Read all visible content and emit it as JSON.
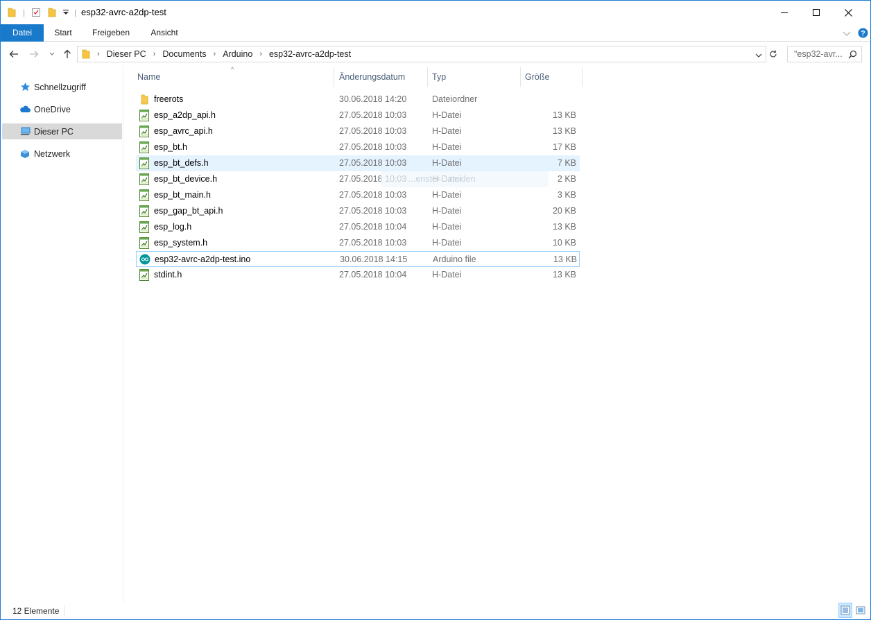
{
  "window": {
    "title": "esp32-avrc-a2dp-test"
  },
  "ribbon": {
    "tabs": [
      {
        "label": "Datei",
        "active": true
      },
      {
        "label": "Start",
        "active": false
      },
      {
        "label": "Freigeben",
        "active": false
      },
      {
        "label": "Ansicht",
        "active": false
      }
    ]
  },
  "address": {
    "breadcrumbs": [
      "Dieser PC",
      "Documents",
      "Arduino",
      "esp32-avrc-a2dp-test"
    ],
    "search_placeholder": "\"esp32-avr..."
  },
  "sidebar": {
    "items": [
      {
        "label": "Schnellzugriff",
        "icon": "star-icon",
        "selected": false
      },
      {
        "label": "OneDrive",
        "icon": "cloud-icon",
        "selected": false
      },
      {
        "label": "Dieser PC",
        "icon": "computer-icon",
        "selected": true
      },
      {
        "label": "Netzwerk",
        "icon": "network-icon",
        "selected": false
      }
    ]
  },
  "columns": {
    "name": "Name",
    "date": "Änderungsdatum",
    "type": "Typ",
    "size": "Größe"
  },
  "files": [
    {
      "name": "freerots",
      "date": "30.06.2018 14:20",
      "type": "Dateiordner",
      "size": "",
      "icon": "folder-icon"
    },
    {
      "name": "esp_a2dp_api.h",
      "date": "27.05.2018 10:03",
      "type": "H-Datei",
      "size": "13 KB",
      "icon": "header-file-icon"
    },
    {
      "name": "esp_avrc_api.h",
      "date": "27.05.2018 10:03",
      "type": "H-Datei",
      "size": "13 KB",
      "icon": "header-file-icon"
    },
    {
      "name": "esp_bt.h",
      "date": "27.05.2018 10:03",
      "type": "H-Datei",
      "size": "17 KB",
      "icon": "header-file-icon"
    },
    {
      "name": "esp_bt_defs.h",
      "date": "27.05.2018 10:03",
      "type": "H-Datei",
      "size": "7 KB",
      "icon": "header-file-icon",
      "state": "hover"
    },
    {
      "name": "esp_bt_device.h",
      "date": "27.05.2018 10:03",
      "type": "H-Datei",
      "size": "2 KB",
      "icon": "header-file-icon"
    },
    {
      "name": "esp_bt_main.h",
      "date": "27.05.2018 10:03",
      "type": "H-Datei",
      "size": "3 KB",
      "icon": "header-file-icon"
    },
    {
      "name": "esp_gap_bt_api.h",
      "date": "27.05.2018 10:03",
      "type": "H-Datei",
      "size": "20 KB",
      "icon": "header-file-icon"
    },
    {
      "name": "esp_log.h",
      "date": "27.05.2018 10:04",
      "type": "H-Datei",
      "size": "13 KB",
      "icon": "header-file-icon"
    },
    {
      "name": "esp_system.h",
      "date": "27.05.2018 10:03",
      "type": "H-Datei",
      "size": "10 KB",
      "icon": "header-file-icon"
    },
    {
      "name": "esp32-avrc-a2dp-test.ino",
      "date": "30.06.2018 14:15",
      "type": "Arduino file",
      "size": "13 KB",
      "icon": "arduino-file-icon",
      "state": "focus"
    },
    {
      "name": "stdint.h",
      "date": "27.05.2018 10:04",
      "type": "H-Datei",
      "size": "13 KB",
      "icon": "header-file-icon"
    }
  ],
  "ghost_tooltip": "...enster ...neiden",
  "status": {
    "item_count": "12 Elemente"
  },
  "colors": {
    "accent": "#1979ca",
    "selection_hover": "#e5f3ff",
    "focus_border": "#99d1ff",
    "sidebar_selected": "#d9d9d9"
  }
}
